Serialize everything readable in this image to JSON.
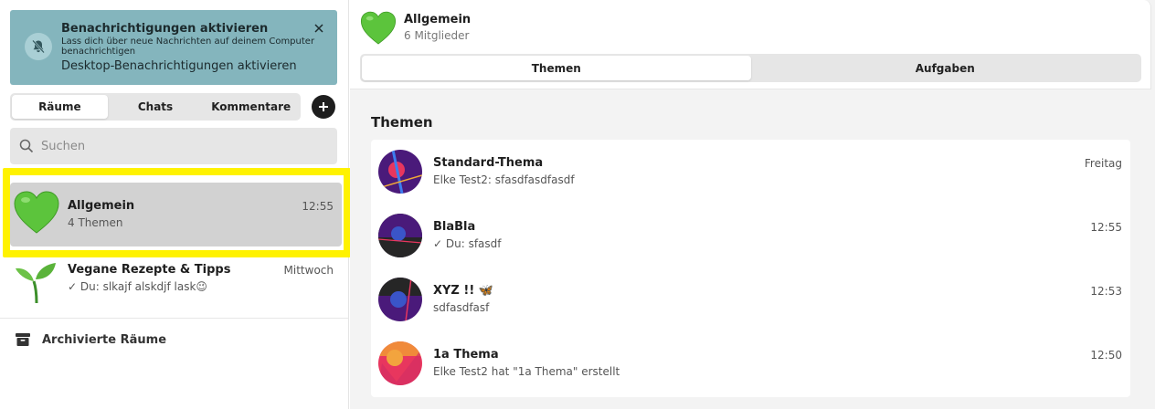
{
  "notification": {
    "title": "Benachrichtigungen aktivieren",
    "description": "Lass dich über neue Nachrichten auf deinem Computer benachrichtigen",
    "action": "Desktop-Benachrichtigungen aktivieren",
    "background": "#84b5bd"
  },
  "sidebar": {
    "tabs": [
      {
        "label": "Räume",
        "active": true
      },
      {
        "label": "Chats",
        "active": false
      },
      {
        "label": "Kommentare",
        "active": false
      }
    ],
    "search_placeholder": "Suchen",
    "rooms": [
      {
        "emoji": "green-heart",
        "name": "Allgemein",
        "subtitle": "4 Themen",
        "time": "12:55",
        "selected": true
      },
      {
        "emoji": "seedling",
        "name": "Vegane Rezepte & Tipps",
        "subtitle": "✓ Du: slkajf alskdjf lask😉",
        "time": "Mittwoch",
        "selected": false
      }
    ],
    "archived_label": "Archivierte Räume",
    "highlight_color": "#fff200"
  },
  "header": {
    "room_name": "Allgemein",
    "members": "6 Mitglieder",
    "tabs": [
      {
        "label": "Themen",
        "active": true
      },
      {
        "label": "Aufgaben",
        "active": false
      }
    ]
  },
  "topics": {
    "section_title": "Themen",
    "items": [
      {
        "name": "Standard-Thema",
        "subtitle": "Elke Test2: sfasdfasdfasdf",
        "time": "Freitag"
      },
      {
        "name": "BlaBla",
        "subtitle": "✓ Du: sfasdf",
        "time": "12:55"
      },
      {
        "name": "XYZ !! 🦋",
        "subtitle": "sdfasdfasf",
        "time": "12:53"
      },
      {
        "name": "1a Thema",
        "subtitle": "Elke Test2 hat \"1a Thema\" erstellt",
        "time": "12:50"
      }
    ]
  }
}
